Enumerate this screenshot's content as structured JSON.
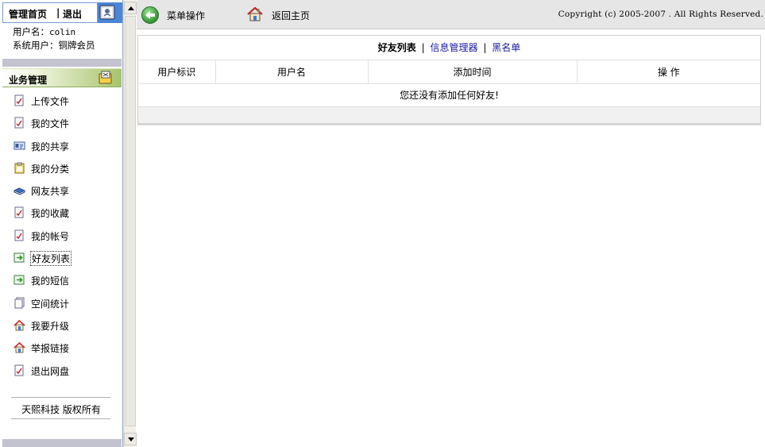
{
  "left": {
    "home_link": "管理首页",
    "separator": "|",
    "logout_link": "退出",
    "username_label": "用户名：",
    "username_value": "colin",
    "system_user_label": "系统用户：",
    "system_user_value": "铜牌会员",
    "section_title": "业务管理",
    "menu": [
      {
        "label": "上传文件",
        "icon": "document-check-icon"
      },
      {
        "label": "我的文件",
        "icon": "document-check-icon"
      },
      {
        "label": "我的共享",
        "icon": "id-card-icon"
      },
      {
        "label": "我的分类",
        "icon": "clipboard-icon"
      },
      {
        "label": "网友共享",
        "icon": "book-stack-icon"
      },
      {
        "label": "我的收藏",
        "icon": "document-check-icon"
      },
      {
        "label": "我的帐号",
        "icon": "document-check-icon"
      },
      {
        "label": "好友列表",
        "icon": "arrow-doc-icon"
      },
      {
        "label": "我的短信",
        "icon": "arrow-doc-icon"
      },
      {
        "label": "空间统计",
        "icon": "pages-icon"
      },
      {
        "label": "我要升级",
        "icon": "house-icon"
      },
      {
        "label": "举报链接",
        "icon": "house-icon"
      },
      {
        "label": "退出网盘",
        "icon": "document-check-icon"
      }
    ],
    "active_index": 7,
    "footer": "天熙科技 版权所有"
  },
  "toolbar": {
    "menu_ops": "菜单操作",
    "home": "返回主页",
    "copyright": "Copyright (c) 2005-2007 . All Rights Reserved."
  },
  "panel": {
    "tab_current": "好友列表",
    "tab_sep": "|",
    "tab_info": "信息管理器",
    "tab_blacklist": "黑名单",
    "columns": [
      "用户标识",
      "用户名",
      "添加时间",
      "操 作"
    ],
    "empty_message": "您还没有添加任何好友!"
  },
  "colors": {
    "accent_blue": "#4a86d6",
    "section_green": "#a6c46c",
    "link_blue": "#1a1aa6"
  }
}
